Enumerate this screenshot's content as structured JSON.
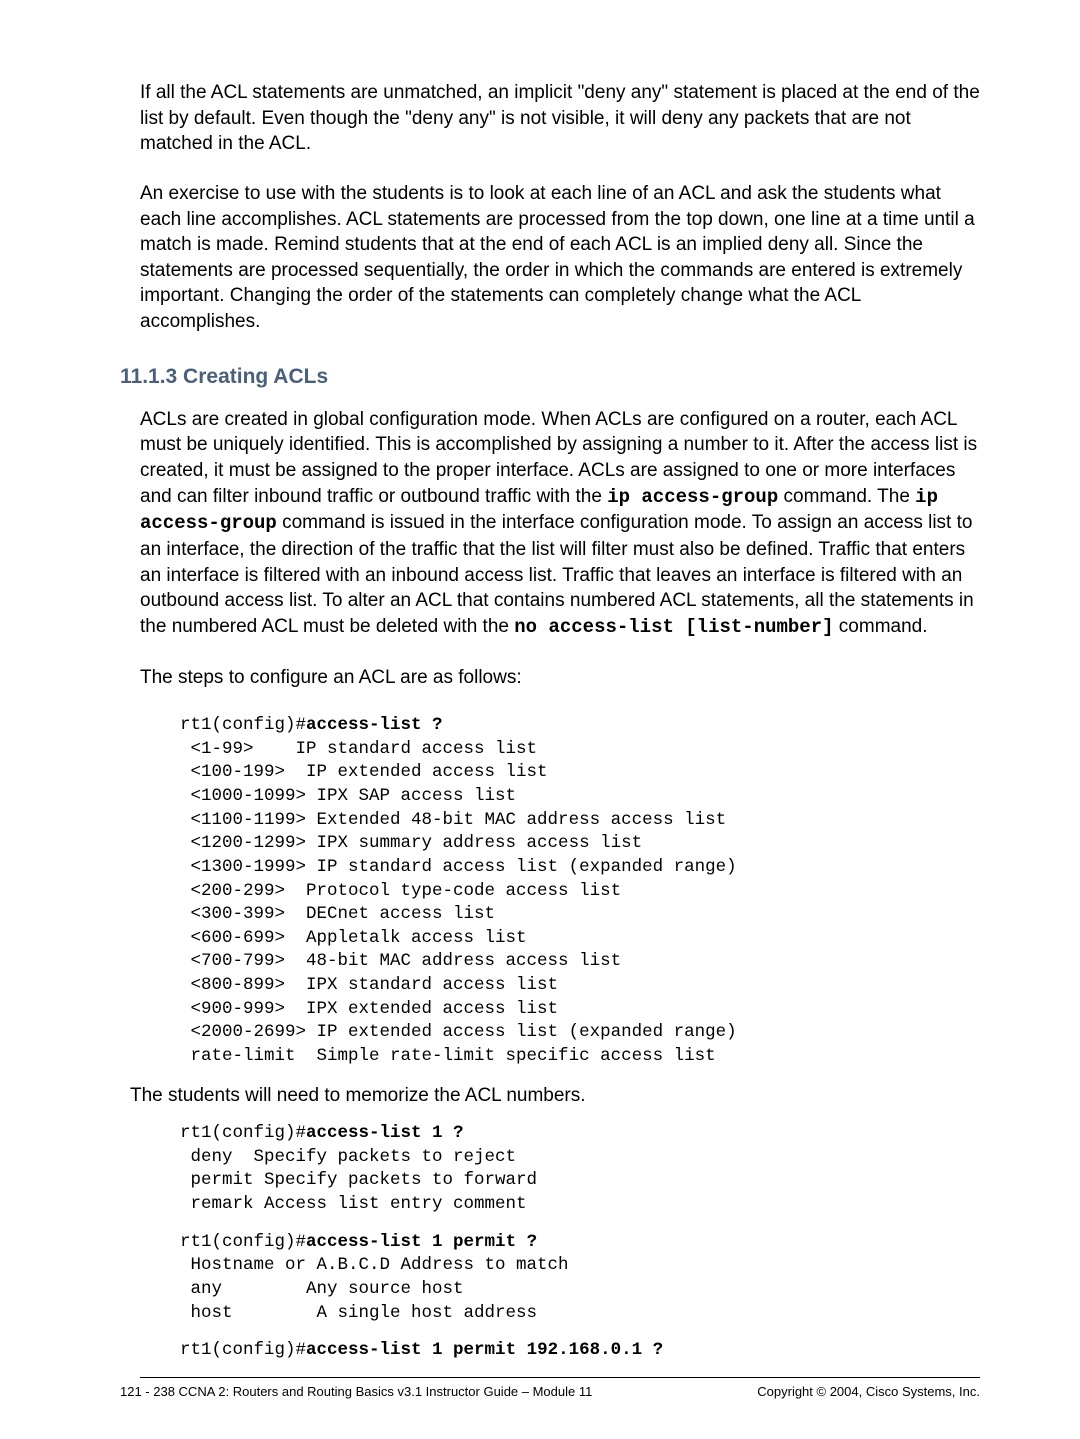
{
  "paragraphs": {
    "p1": "If all the ACL statements are unmatched, an implicit \"deny any\" statement is placed at the end of the list by default. Even though the \"deny any\" is not visible, it will deny any packets that are not matched in the ACL.",
    "p2": "An exercise to use with the students is to look at each line of an ACL and ask the students what each line accomplishes. ACL statements are processed from the top down, one line at a time until a match is made. Remind students that at the end of each ACL is an implied deny all. Since the statements are processed sequentially, the order in which the commands are entered is extremely important. Changing the order of the statements can completely change what the ACL accomplishes.",
    "p3_part1": "ACLs are created in global configuration mode. When ACLs are configured on a router, each ACL must be uniquely identified. This is accomplished by assigning a number to it. After the access list is created, it must be assigned to the proper interface. ACLs are assigned to one or more interfaces and can filter inbound traffic or outbound traffic with the ",
    "p3_code1": "ip access-group",
    "p3_part2": " command. The ",
    "p3_code2": "ip access-group",
    "p3_part3": " command is issued in the interface configuration mode. To assign an access list to an interface, the direction of the traffic that the list will filter must also be defined. Traffic that enters an interface is filtered with an inbound access list. Traffic that leaves an interface is filtered with an outbound access list. To alter an ACL that contains numbered ACL statements, all the statements in the numbered ACL must be deleted with the ",
    "p3_code3": "no access-list [list-number]",
    "p3_part4": " command.",
    "p4": "The steps to configure an ACL are as follows:",
    "p5": "The students will need to memorize the ACL numbers."
  },
  "heading": "11.1.3 Creating ACLs",
  "code1": {
    "prompt": "rt1(config)#",
    "cmd": "access-list ?",
    "lines": " <1-99>    IP standard access list\n <100-199>  IP extended access list\n <1000-1099> IPX SAP access list\n <1100-1199> Extended 48-bit MAC address access list\n <1200-1299> IPX summary address access list\n <1300-1999> IP standard access list (expanded range)\n <200-299>  Protocol type-code access list\n <300-399>  DECnet access list\n <600-699>  Appletalk access list\n <700-799>  48-bit MAC address access list\n <800-899>  IPX standard access list\n <900-999>  IPX extended access list\n <2000-2699> IP extended access list (expanded range)\n rate-limit  Simple rate-limit specific access list"
  },
  "code2": {
    "prompt": "rt1(config)#",
    "cmd": "access-list 1 ?",
    "lines": " deny  Specify packets to reject\n permit Specify packets to forward\n remark Access list entry comment"
  },
  "code3": {
    "prompt": "rt1(config)#",
    "cmd": "access-list 1 permit ?",
    "lines": " Hostname or A.B.C.D Address to match\n any        Any source host\n host        A single host address"
  },
  "code4": {
    "prompt": "rt1(config)#",
    "cmd": "access-list 1 permit 192.168.0.1 ?"
  },
  "footer": {
    "left": "121 - 238    CCNA 2: Routers and Routing Basics v3.1 Instructor Guide – Module 11",
    "right": "Copyright © 2004, Cisco Systems, Inc."
  }
}
